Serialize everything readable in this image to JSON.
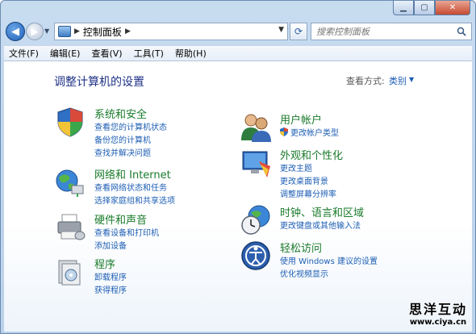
{
  "navigation": {
    "breadcrumb": "控制面板",
    "search_placeholder": "搜索控制面板"
  },
  "menubar": {
    "items": [
      "文件(F)",
      "编辑(E)",
      "查看(V)",
      "工具(T)",
      "帮助(H)"
    ]
  },
  "content": {
    "title": "调整计算机的设置",
    "view_by_label": "查看方式:",
    "view_by_value": "类别"
  },
  "categories": {
    "system": {
      "title": "系统和安全",
      "links": [
        "查看您的计算机状态",
        "备份您的计算机",
        "查找并解决问题"
      ]
    },
    "network": {
      "title": "网络和 Internet",
      "links": [
        "查看网络状态和任务",
        "选择家庭组和共享选项"
      ]
    },
    "hardware": {
      "title": "硬件和声音",
      "links": [
        "查看设备和打印机",
        "添加设备"
      ]
    },
    "programs": {
      "title": "程序",
      "links": [
        "卸载程序",
        "获得程序"
      ]
    },
    "users": {
      "title": "用户帐户",
      "links": [
        "更改帐户类型"
      ]
    },
    "appearance": {
      "title": "外观和个性化",
      "links": [
        "更改主题",
        "更改桌面背景",
        "调整屏幕分辨率"
      ]
    },
    "clock": {
      "title": "时钟、语言和区域",
      "links": [
        "更改键盘或其他输入法"
      ]
    },
    "ease": {
      "title": "轻松访问",
      "links": [
        "使用 Windows 建议的设置",
        "优化视频显示"
      ]
    }
  },
  "watermark": {
    "name": "思洋互动",
    "url": "www.ciya.cn"
  }
}
